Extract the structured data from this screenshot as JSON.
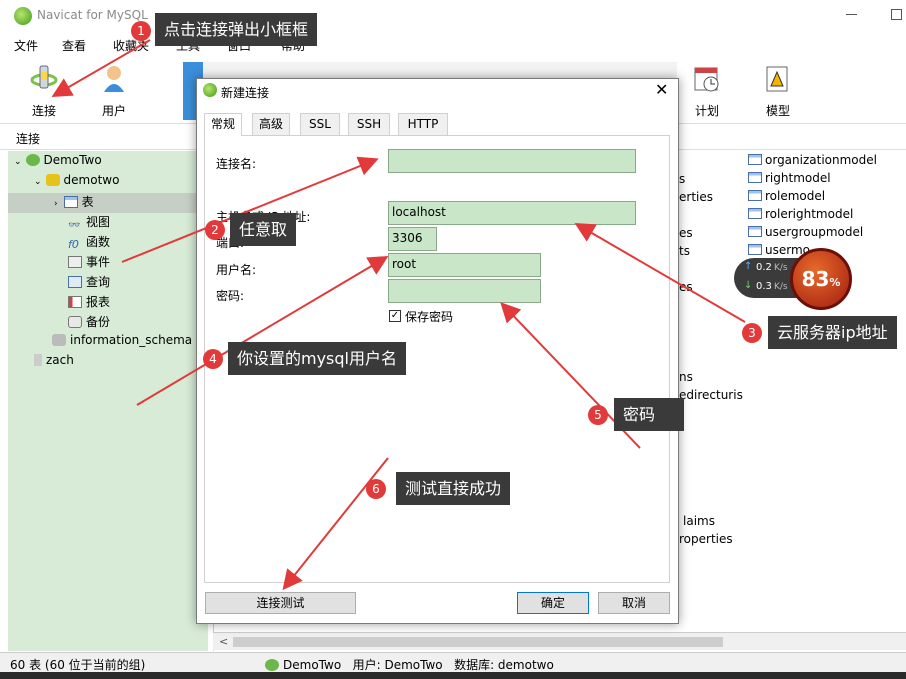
{
  "window": {
    "title": "Navicat for MySQL"
  },
  "menu": [
    "文件",
    "查看",
    "收藏夹",
    "工具",
    "窗口",
    "帮助"
  ],
  "toolbar": {
    "connect": "连接",
    "user": "用户",
    "schedule": "计划",
    "model": "模型"
  },
  "connection_header": "连接",
  "tree": {
    "conn1": "DemoTwo",
    "db1": "demotwo",
    "tables": "表",
    "views": "视图",
    "functions": "函数",
    "events": "事件",
    "queries": "查询",
    "reports": "报表",
    "backups": "备份",
    "db2": "information_schema",
    "conn2": "zach"
  },
  "table_list": [
    "organizationmodel",
    "rightmodel",
    "rolemodel",
    "rolerightmodel",
    "usergroupmodel",
    "usermo"
  ],
  "partial_labels": [
    "s",
    "erties",
    "es",
    "ts",
    "es",
    "ns",
    "edirecturis",
    "laims",
    "roperties"
  ],
  "dialog": {
    "title": "新建连接",
    "tabs": [
      "常规",
      "高级",
      "SSL",
      "SSH",
      "HTTP"
    ],
    "labels": {
      "conn_name": "连接名:",
      "host": "主机名或 IP 地址:",
      "port": "端口:",
      "username": "用户名:",
      "password": "密码:"
    },
    "values": {
      "conn_name": "",
      "host": "localhost",
      "port": "3306",
      "username": "root",
      "password": ""
    },
    "save_password": "保存密码",
    "test_button": "连接测试",
    "ok_button": "确定",
    "cancel_button": "取消"
  },
  "status": {
    "left": "60 表 (60 位于当前的组)",
    "connection": "DemoTwo",
    "user": "用户: DemoTwo",
    "database": "数据库: demotwo"
  },
  "annotations": [
    {
      "num": "1",
      "text": "点击连接弹出小框框"
    },
    {
      "num": "2",
      "text": "任意取"
    },
    {
      "num": "3",
      "text": "云服务器ip地址"
    },
    {
      "num": "4",
      "text": "你设置的mysql用户名"
    },
    {
      "num": "5",
      "text": "密码"
    },
    {
      "num": "6",
      "text": "测试直接成功"
    }
  ],
  "speed_widget": {
    "up": "0.2",
    "down": "0.3",
    "unit": "K/s",
    "percent": "83",
    "percent_sign": "%"
  },
  "colors": {
    "sidebar_bg": "#d7ebd7",
    "input_bg": "#c9e6c9",
    "callout_bg": "#3a3a3a",
    "badge": "#e23a3a",
    "arrow": "#e23a3a"
  }
}
